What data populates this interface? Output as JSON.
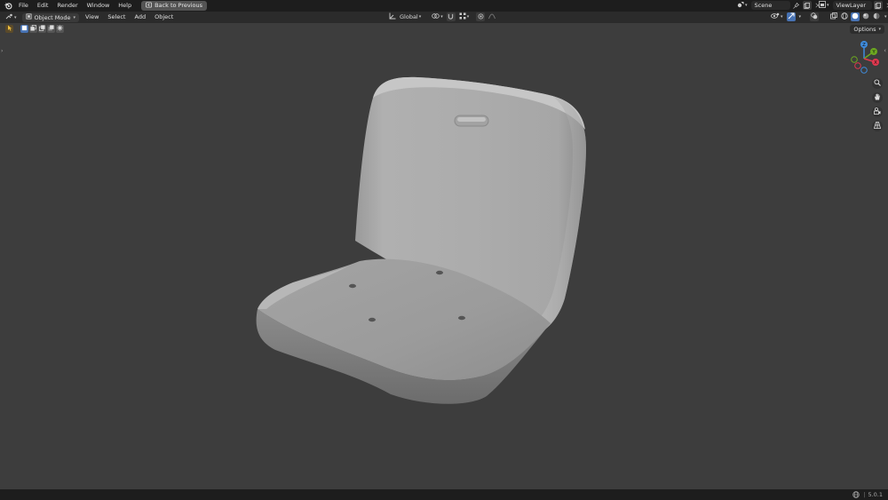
{
  "topbar": {
    "menus": [
      "File",
      "Edit",
      "Render",
      "Window",
      "Help"
    ],
    "back_button": "Back to Previous",
    "scene_name": "Scene",
    "view_layer": "ViewLayer"
  },
  "header": {
    "mode": "Object Mode",
    "menus": [
      "View",
      "Select",
      "Add",
      "Object"
    ],
    "transform_orientation": "Global"
  },
  "viewport": {
    "options_label": "Options",
    "gizmo": {
      "x": "X",
      "y": "Y",
      "z": "Z"
    }
  },
  "statusbar": {
    "version": "5.0.1"
  },
  "colors": {
    "accent": "#4772b3",
    "axis_x": "#e2384f",
    "axis_y": "#6ca820",
    "axis_z": "#3f8cde"
  },
  "icons": [
    "blender-logo-icon",
    "back-icon",
    "scene-icon",
    "pin-icon",
    "new-scene-icon",
    "close-icon",
    "view-layer-icon",
    "editor-type-icon",
    "object-mode-icon",
    "transform-orientation-icon",
    "pivot-icon",
    "snap-icon",
    "proportional-icon",
    "visibility-icon",
    "gizmo-icon",
    "overlay-icon",
    "xray-icon",
    "wireframe-shading-icon",
    "solid-shading-icon",
    "material-shading-icon",
    "rendered-shading-icon",
    "select-tool-icon",
    "zoom-icon",
    "pan-icon",
    "camera-icon",
    "perspective-icon",
    "globe-icon"
  ]
}
